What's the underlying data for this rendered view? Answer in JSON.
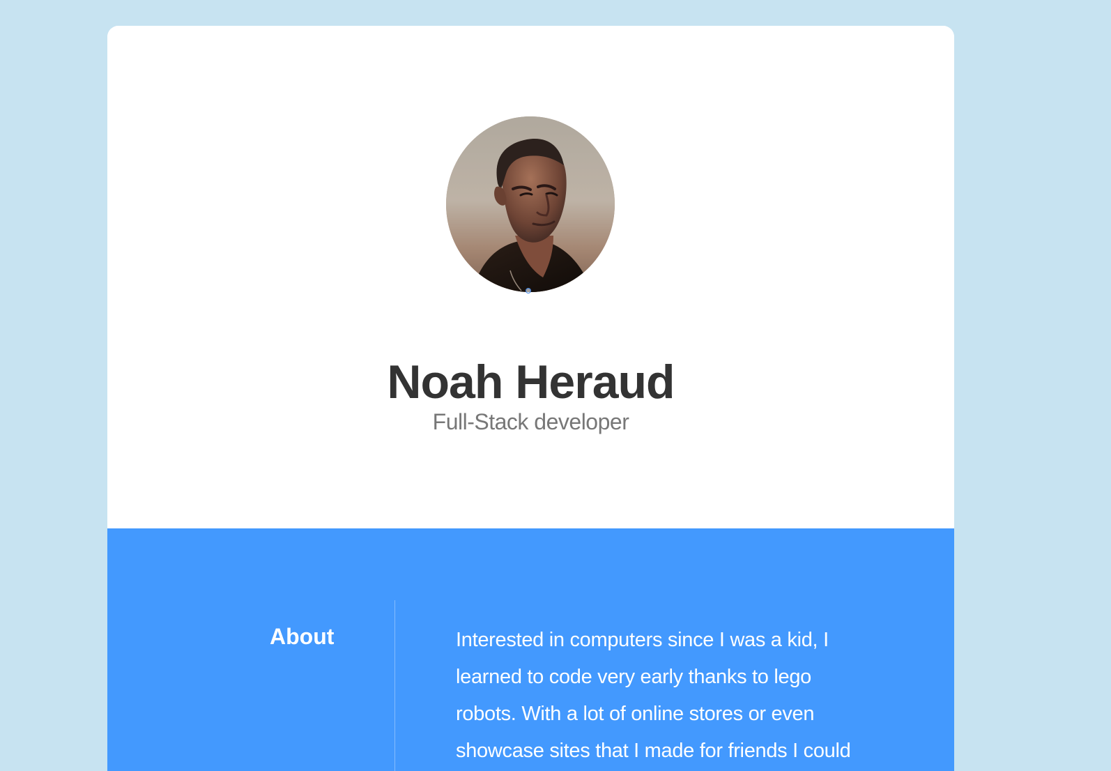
{
  "profile": {
    "name": "Noah Heraud",
    "role": "Full-Stack developer",
    "avatar_icon": "profile-photo"
  },
  "about": {
    "heading": "About",
    "text": "Interested in computers since I was a kid, I learned to code very early thanks to lego robots. With a lot of online stores or even showcase sites that I made for friends I could know the basics of web development"
  },
  "colors": {
    "page_background": "#c7e3f1",
    "card_background": "#ffffff",
    "about_background": "#4399fe",
    "name_text": "#333333",
    "role_text": "#777777",
    "about_text": "#ffffff"
  }
}
